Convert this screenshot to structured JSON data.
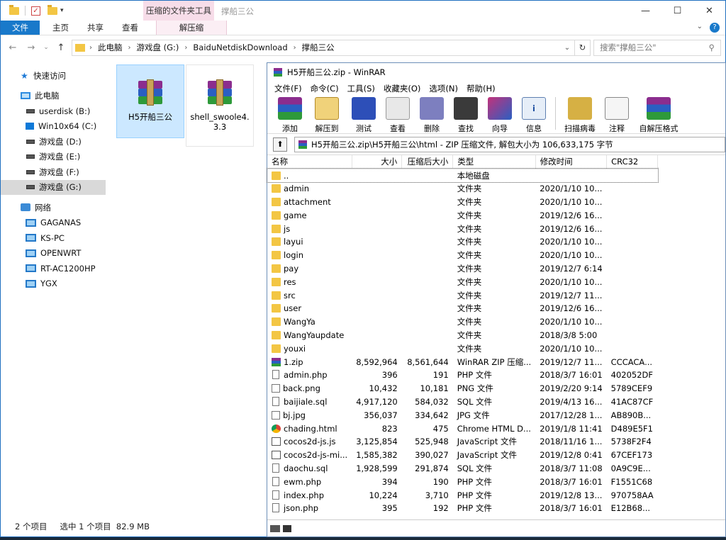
{
  "explorer": {
    "title": "撑船三公",
    "context_tab_header": "压缩的文件夹工具",
    "ribbon_tabs": [
      "文件",
      "主页",
      "共享",
      "查看",
      "解压缩"
    ],
    "breadcrumb": [
      "此电脑",
      "游戏盘 (G:)",
      "BaiduNetdiskDownload",
      "撑船三公"
    ],
    "search_placeholder": "搜索\"撑船三公\"",
    "sidebar": {
      "quick_access": "快速访问",
      "this_pc": "此电脑",
      "drives": [
        "userdisk (B:)",
        "Win10x64 (C:)",
        "游戏盘 (D:)",
        "游戏盘 (E:)",
        "游戏盘 (F:)",
        "游戏盘 (G:)"
      ],
      "network": "网络",
      "hosts": [
        "GAGANAS",
        "KS-PC",
        "OPENWRT",
        "RT-AC1200HP",
        "YGX"
      ]
    },
    "files": [
      {
        "name": "H5开船三公",
        "selected": true
      },
      {
        "name": "shell_swoole4.3.3",
        "selected": false
      }
    ],
    "status": {
      "count": "2 个项目",
      "selection": "选中 1 个项目  82.9 MB"
    }
  },
  "winrar": {
    "title": "H5开船三公.zip - WinRAR",
    "menu": [
      "文件(F)",
      "命令(C)",
      "工具(S)",
      "收藏夹(O)",
      "选项(N)",
      "帮助(H)"
    ],
    "toolbar": [
      "添加",
      "解压到",
      "测试",
      "查看",
      "删除",
      "查找",
      "向导",
      "信息",
      "扫描病毒",
      "注释",
      "自解压格式"
    ],
    "path": "H5开船三公.zip\\H5开船三公\\html - ZIP 压缩文件, 解包大小为 106,633,175 字节",
    "columns": [
      "名称",
      "大小",
      "压缩后大小",
      "类型",
      "修改时间",
      "CRC32"
    ],
    "rows": [
      {
        "icon": "folder",
        "name": "..",
        "size": "",
        "packed": "",
        "type": "本地磁盘",
        "modified": "",
        "crc": ""
      },
      {
        "icon": "folder",
        "name": "admin",
        "size": "",
        "packed": "",
        "type": "文件夹",
        "modified": "2020/1/10 10...",
        "crc": ""
      },
      {
        "icon": "folder",
        "name": "attachment",
        "size": "",
        "packed": "",
        "type": "文件夹",
        "modified": "2020/1/10 10...",
        "crc": ""
      },
      {
        "icon": "folder",
        "name": "game",
        "size": "",
        "packed": "",
        "type": "文件夹",
        "modified": "2019/12/6 16...",
        "crc": ""
      },
      {
        "icon": "folder",
        "name": "js",
        "size": "",
        "packed": "",
        "type": "文件夹",
        "modified": "2019/12/6 16...",
        "crc": ""
      },
      {
        "icon": "folder",
        "name": "layui",
        "size": "",
        "packed": "",
        "type": "文件夹",
        "modified": "2020/1/10 10...",
        "crc": ""
      },
      {
        "icon": "folder",
        "name": "login",
        "size": "",
        "packed": "",
        "type": "文件夹",
        "modified": "2020/1/10 10...",
        "crc": ""
      },
      {
        "icon": "folder",
        "name": "pay",
        "size": "",
        "packed": "",
        "type": "文件夹",
        "modified": "2019/12/7 6:14",
        "crc": ""
      },
      {
        "icon": "folder",
        "name": "res",
        "size": "",
        "packed": "",
        "type": "文件夹",
        "modified": "2020/1/10 10...",
        "crc": ""
      },
      {
        "icon": "folder",
        "name": "src",
        "size": "",
        "packed": "",
        "type": "文件夹",
        "modified": "2019/12/7 11...",
        "crc": ""
      },
      {
        "icon": "folder",
        "name": "user",
        "size": "",
        "packed": "",
        "type": "文件夹",
        "modified": "2019/12/6 16...",
        "crc": ""
      },
      {
        "icon": "folder",
        "name": "WangYa",
        "size": "",
        "packed": "",
        "type": "文件夹",
        "modified": "2020/1/10 10...",
        "crc": ""
      },
      {
        "icon": "folder",
        "name": "WangYaupdate",
        "size": "",
        "packed": "",
        "type": "文件夹",
        "modified": "2018/3/8 5:00",
        "crc": ""
      },
      {
        "icon": "folder",
        "name": "youxi",
        "size": "",
        "packed": "",
        "type": "文件夹",
        "modified": "2020/1/10 10...",
        "crc": ""
      },
      {
        "icon": "zip",
        "name": "1.zip",
        "size": "8,592,964",
        "packed": "8,561,644",
        "type": "WinRAR ZIP 压缩...",
        "modified": "2019/12/7 11...",
        "crc": "CCCACA..."
      },
      {
        "icon": "doc",
        "name": "admin.php",
        "size": "396",
        "packed": "191",
        "type": "PHP 文件",
        "modified": "2018/3/7 16:01",
        "crc": "402052DF"
      },
      {
        "icon": "img",
        "name": "back.png",
        "size": "10,432",
        "packed": "10,181",
        "type": "PNG 文件",
        "modified": "2019/2/20 9:14",
        "crc": "5789CEF9"
      },
      {
        "icon": "doc",
        "name": "baijiale.sql",
        "size": "4,917,120",
        "packed": "584,032",
        "type": "SQL 文件",
        "modified": "2019/4/13 16...",
        "crc": "41AC87CF"
      },
      {
        "icon": "img",
        "name": "bj.jpg",
        "size": "356,037",
        "packed": "334,642",
        "type": "JPG 文件",
        "modified": "2017/12/28 1...",
        "crc": "AB890B..."
      },
      {
        "icon": "chrome",
        "name": "chading.html",
        "size": "823",
        "packed": "475",
        "type": "Chrome HTML D...",
        "modified": "2019/1/8 11:41",
        "crc": "D489E5F1"
      },
      {
        "icon": "js",
        "name": "cocos2d-js.js",
        "size": "3,125,854",
        "packed": "525,948",
        "type": "JavaScript 文件",
        "modified": "2018/11/16 1...",
        "crc": "5738F2F4"
      },
      {
        "icon": "js",
        "name": "cocos2d-js-mi...",
        "size": "1,585,382",
        "packed": "390,027",
        "type": "JavaScript 文件",
        "modified": "2019/12/8 0:41",
        "crc": "67CEF173"
      },
      {
        "icon": "doc",
        "name": "daochu.sql",
        "size": "1,928,599",
        "packed": "291,874",
        "type": "SQL 文件",
        "modified": "2018/3/7 11:08",
        "crc": "0A9C9E..."
      },
      {
        "icon": "doc",
        "name": "ewm.php",
        "size": "394",
        "packed": "190",
        "type": "PHP 文件",
        "modified": "2018/3/7 16:01",
        "crc": "F1551C68"
      },
      {
        "icon": "doc",
        "name": "index.php",
        "size": "10,224",
        "packed": "3,710",
        "type": "PHP 文件",
        "modified": "2019/12/8 13...",
        "crc": "970758AA"
      },
      {
        "icon": "doc",
        "name": "json.php",
        "size": "395",
        "packed": "192",
        "type": "PHP 文件",
        "modified": "2018/3/7 16:01",
        "crc": "E12B68..."
      }
    ]
  }
}
